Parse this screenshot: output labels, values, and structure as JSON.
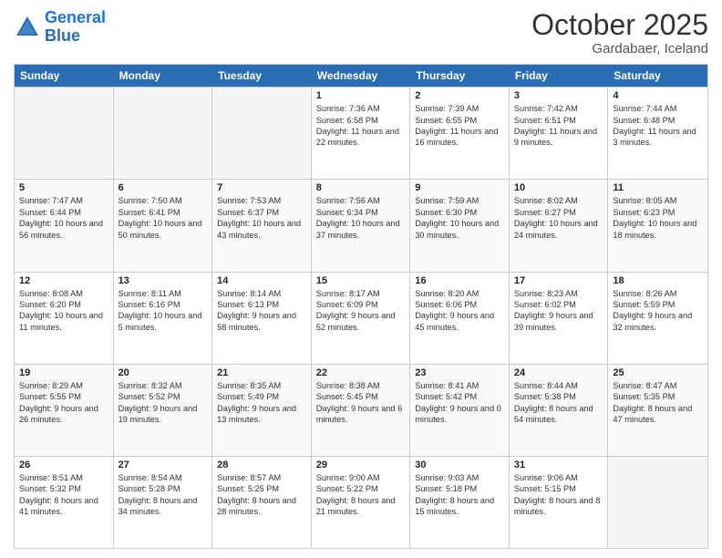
{
  "logo": {
    "line1": "General",
    "line2": "Blue"
  },
  "title": "October 2025",
  "location": "Gardabaer, Iceland",
  "days": [
    "Sunday",
    "Monday",
    "Tuesday",
    "Wednesday",
    "Thursday",
    "Friday",
    "Saturday"
  ],
  "weeks": [
    [
      {
        "day": "",
        "empty": true
      },
      {
        "day": "",
        "empty": true
      },
      {
        "day": "",
        "empty": true
      },
      {
        "day": "1",
        "rise": "Sunrise: 7:36 AM",
        "set": "Sunset: 6:58 PM",
        "light": "Daylight: 11 hours and 22 minutes."
      },
      {
        "day": "2",
        "rise": "Sunrise: 7:39 AM",
        "set": "Sunset: 6:55 PM",
        "light": "Daylight: 11 hours and 16 minutes."
      },
      {
        "day": "3",
        "rise": "Sunrise: 7:42 AM",
        "set": "Sunset: 6:51 PM",
        "light": "Daylight: 11 hours and 9 minutes."
      },
      {
        "day": "4",
        "rise": "Sunrise: 7:44 AM",
        "set": "Sunset: 6:48 PM",
        "light": "Daylight: 11 hours and 3 minutes."
      }
    ],
    [
      {
        "day": "5",
        "rise": "Sunrise: 7:47 AM",
        "set": "Sunset: 6:44 PM",
        "light": "Daylight: 10 hours and 56 minutes."
      },
      {
        "day": "6",
        "rise": "Sunrise: 7:50 AM",
        "set": "Sunset: 6:41 PM",
        "light": "Daylight: 10 hours and 50 minutes."
      },
      {
        "day": "7",
        "rise": "Sunrise: 7:53 AM",
        "set": "Sunset: 6:37 PM",
        "light": "Daylight: 10 hours and 43 minutes."
      },
      {
        "day": "8",
        "rise": "Sunrise: 7:56 AM",
        "set": "Sunset: 6:34 PM",
        "light": "Daylight: 10 hours and 37 minutes."
      },
      {
        "day": "9",
        "rise": "Sunrise: 7:59 AM",
        "set": "Sunset: 6:30 PM",
        "light": "Daylight: 10 hours and 30 minutes."
      },
      {
        "day": "10",
        "rise": "Sunrise: 8:02 AM",
        "set": "Sunset: 6:27 PM",
        "light": "Daylight: 10 hours and 24 minutes."
      },
      {
        "day": "11",
        "rise": "Sunrise: 8:05 AM",
        "set": "Sunset: 6:23 PM",
        "light": "Daylight: 10 hours and 18 minutes."
      }
    ],
    [
      {
        "day": "12",
        "rise": "Sunrise: 8:08 AM",
        "set": "Sunset: 6:20 PM",
        "light": "Daylight: 10 hours and 11 minutes."
      },
      {
        "day": "13",
        "rise": "Sunrise: 8:11 AM",
        "set": "Sunset: 6:16 PM",
        "light": "Daylight: 10 hours and 5 minutes."
      },
      {
        "day": "14",
        "rise": "Sunrise: 8:14 AM",
        "set": "Sunset: 6:13 PM",
        "light": "Daylight: 9 hours and 58 minutes."
      },
      {
        "day": "15",
        "rise": "Sunrise: 8:17 AM",
        "set": "Sunset: 6:09 PM",
        "light": "Daylight: 9 hours and 52 minutes."
      },
      {
        "day": "16",
        "rise": "Sunrise: 8:20 AM",
        "set": "Sunset: 6:06 PM",
        "light": "Daylight: 9 hours and 45 minutes."
      },
      {
        "day": "17",
        "rise": "Sunrise: 8:23 AM",
        "set": "Sunset: 6:02 PM",
        "light": "Daylight: 9 hours and 39 minutes."
      },
      {
        "day": "18",
        "rise": "Sunrise: 8:26 AM",
        "set": "Sunset: 5:59 PM",
        "light": "Daylight: 9 hours and 32 minutes."
      }
    ],
    [
      {
        "day": "19",
        "rise": "Sunrise: 8:29 AM",
        "set": "Sunset: 5:55 PM",
        "light": "Daylight: 9 hours and 26 minutes."
      },
      {
        "day": "20",
        "rise": "Sunrise: 8:32 AM",
        "set": "Sunset: 5:52 PM",
        "light": "Daylight: 9 hours and 19 minutes."
      },
      {
        "day": "21",
        "rise": "Sunrise: 8:35 AM",
        "set": "Sunset: 5:49 PM",
        "light": "Daylight: 9 hours and 13 minutes."
      },
      {
        "day": "22",
        "rise": "Sunrise: 8:38 AM",
        "set": "Sunset: 5:45 PM",
        "light": "Daylight: 9 hours and 6 minutes."
      },
      {
        "day": "23",
        "rise": "Sunrise: 8:41 AM",
        "set": "Sunset: 5:42 PM",
        "light": "Daylight: 9 hours and 0 minutes."
      },
      {
        "day": "24",
        "rise": "Sunrise: 8:44 AM",
        "set": "Sunset: 5:38 PM",
        "light": "Daylight: 8 hours and 54 minutes."
      },
      {
        "day": "25",
        "rise": "Sunrise: 8:47 AM",
        "set": "Sunset: 5:35 PM",
        "light": "Daylight: 8 hours and 47 minutes."
      }
    ],
    [
      {
        "day": "26",
        "rise": "Sunrise: 8:51 AM",
        "set": "Sunset: 5:32 PM",
        "light": "Daylight: 8 hours and 41 minutes."
      },
      {
        "day": "27",
        "rise": "Sunrise: 8:54 AM",
        "set": "Sunset: 5:28 PM",
        "light": "Daylight: 8 hours and 34 minutes."
      },
      {
        "day": "28",
        "rise": "Sunrise: 8:57 AM",
        "set": "Sunset: 5:25 PM",
        "light": "Daylight: 8 hours and 28 minutes."
      },
      {
        "day": "29",
        "rise": "Sunrise: 9:00 AM",
        "set": "Sunset: 5:22 PM",
        "light": "Daylight: 8 hours and 21 minutes."
      },
      {
        "day": "30",
        "rise": "Sunrise: 9:03 AM",
        "set": "Sunset: 5:18 PM",
        "light": "Daylight: 8 hours and 15 minutes."
      },
      {
        "day": "31",
        "rise": "Sunrise: 9:06 AM",
        "set": "Sunset: 5:15 PM",
        "light": "Daylight: 8 hours and 8 minutes."
      },
      {
        "day": "",
        "empty": true
      }
    ]
  ]
}
